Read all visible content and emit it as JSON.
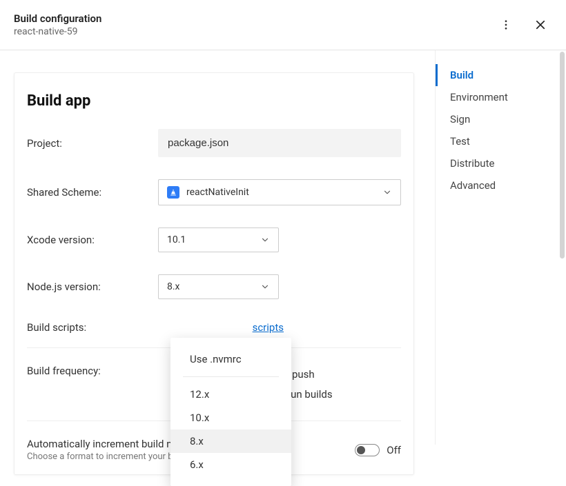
{
  "header": {
    "title": "Build configuration",
    "subtitle": "react-native-59"
  },
  "sidebar": {
    "items": [
      {
        "label": "Build",
        "active": true
      },
      {
        "label": "Environment",
        "active": false
      },
      {
        "label": "Sign",
        "active": false
      },
      {
        "label": "Test",
        "active": false
      },
      {
        "label": "Distribute",
        "active": false
      },
      {
        "label": "Advanced",
        "active": false
      }
    ]
  },
  "form": {
    "card_title": "Build app",
    "project_label": "Project:",
    "project_value": "package.json",
    "shared_scheme_label": "Shared Scheme:",
    "shared_scheme_value": "reactNativeInit",
    "xcode_label": "Xcode version:",
    "xcode_value": "10.1",
    "node_label": "Node.js version:",
    "node_value": "8.x",
    "build_scripts_label": "Build scripts:",
    "build_scripts_link": "scripts",
    "build_frequency_label": "Build frequency:",
    "freq_line1_suffix": "ery push",
    "freq_line2_suffix": "to run builds",
    "auto_increment_title": "Automatically increment build number",
    "auto_increment_sub": "Choose a format to increment your builds.",
    "toggle_state": "Off"
  },
  "node_dropdown": {
    "top_option": "Use .nvmrc",
    "options": [
      "12.x",
      "10.x",
      "8.x",
      "6.x"
    ],
    "selected": "8.x"
  }
}
